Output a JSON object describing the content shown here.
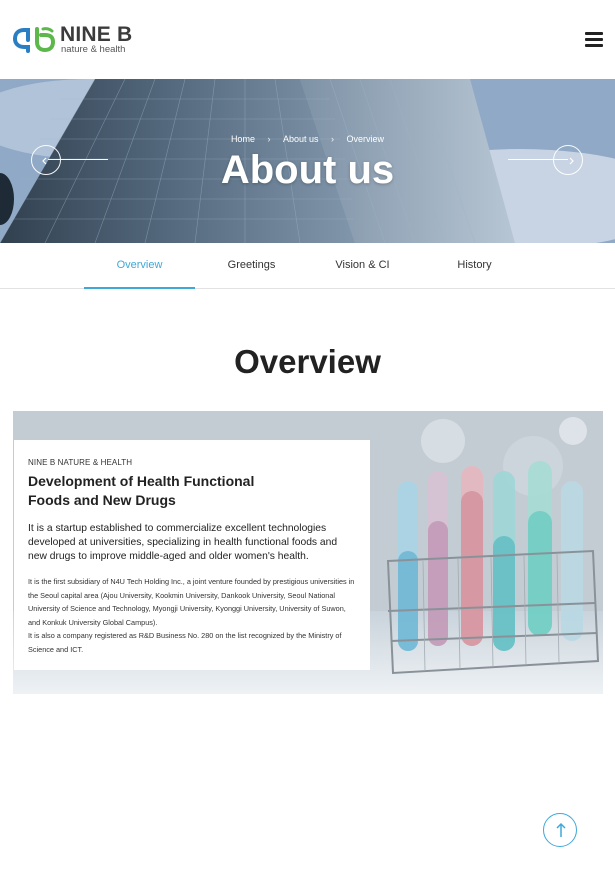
{
  "header": {
    "logo_title": "NINE B",
    "logo_subtitle": "nature & health",
    "menu_icon": "hamburger-menu-icon"
  },
  "hero": {
    "breadcrumb": [
      "Home",
      "About us",
      "Overview"
    ],
    "title": "About us",
    "prev_icon": "arrow-left-icon",
    "next_icon": "arrow-right-icon"
  },
  "tabs": [
    {
      "label": "Overview",
      "active": true
    },
    {
      "label": "Greetings",
      "active": false
    },
    {
      "label": "Vision & CI",
      "active": false
    },
    {
      "label": "History",
      "active": false
    }
  ],
  "section": {
    "title": "Overview"
  },
  "overview": {
    "eyebrow": "NINE B NATURE & HEALTH",
    "title": "Development of Health Functional Foods and New Drugs",
    "lead": "It is a startup established to commercialize excellent technologies developed at universities, specializing in health functional foods and new drugs to improve middle-aged and older women's health.",
    "body_1": "It is the first subsidiary of N4U Tech Holding Inc., a joint venture founded by prestigious universities in the Seoul capital area (Ajou University, Kookmin University, Dankook University, Seoul National University of Science and Technology, Myongji University, Kyonggi University, University of Suwon, and Konkuk University Global Campus).",
    "body_2": "It is also a company registered as R&D Business No. 280 on the list recognized by the Ministry of Science and ICT."
  },
  "top_button_icon": "arrow-up-icon",
  "colors": {
    "accent": "#3ea8d8",
    "logo_blue": "#2a7fc4",
    "logo_green": "#5cb84a"
  }
}
